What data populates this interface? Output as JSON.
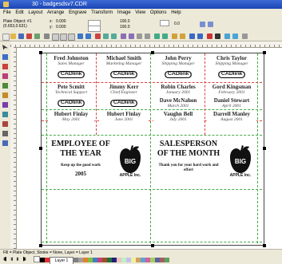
{
  "window": {
    "title": "30 - badgesdsv7.CDR"
  },
  "menu": [
    "File",
    "Edit",
    "Layout",
    "Arrange",
    "Engrave",
    "Transform",
    "Image",
    "View",
    "Options",
    "Help"
  ],
  "property_bar": {
    "object_label": "Plate Object: #1",
    "object_coords": "(0.653,0.631)",
    "x_label": "x:",
    "x_value": "0.000",
    "y_label": "y:",
    "y_value": "0.000",
    "lock_value": "100.0",
    "angle_value": "0.0"
  },
  "badges": [
    {
      "name": "Fred Johnston",
      "title": "Sales Manager"
    },
    {
      "name": "Michael Smith",
      "title": "Marketing Manager"
    },
    {
      "name": "John Perry",
      "title": "Shipping Manager"
    },
    {
      "name": "Chris Taylor",
      "title": "Shipping Manager"
    },
    {
      "name": "Pete Scmitt",
      "title": "Technical Support"
    },
    {
      "name": "Jimmy Kerr",
      "title": "Chief Engineer"
    },
    {
      "name": "Robin Charles",
      "title": "January 2001"
    },
    {
      "name": "Gord Kingsman",
      "title": "February 2001"
    },
    {
      "name": "Dave McNahon",
      "title": "March 2001"
    },
    {
      "name": "Daniel Stewart",
      "title": "April 2001"
    },
    {
      "name": "Hubert Finlay",
      "title": "May 2001"
    },
    {
      "name": "Hubert Finlay",
      "title": "June 2001"
    },
    {
      "name": "Vaughn Bell",
      "title": "July 2001"
    },
    {
      "name": "Darrell Manley",
      "title": "August 2001"
    }
  ],
  "logo_text": "CADlink",
  "certificates": [
    {
      "line1": "EMPLOYEE OF",
      "line2": "THE YEAR",
      "message": "Keep up the good work",
      "year": "2005",
      "brand_big": "BIG",
      "brand_small": "APPLE Inc."
    },
    {
      "line1": "SALESPERSON",
      "line2": "OF THE MONTH",
      "message": "Thank you for your hard work and effort",
      "year": "",
      "brand_big": "BIG",
      "brand_small": "APPLE Inc."
    }
  ],
  "status": {
    "text": "Fill = Plate Object, Stroke = None, Layer = Layer 1",
    "layer_tab": "Layer 1"
  },
  "colors": {
    "titlebar": "#2a59c8",
    "guide_green": "#44aa44",
    "guide_red": "#e04040"
  }
}
